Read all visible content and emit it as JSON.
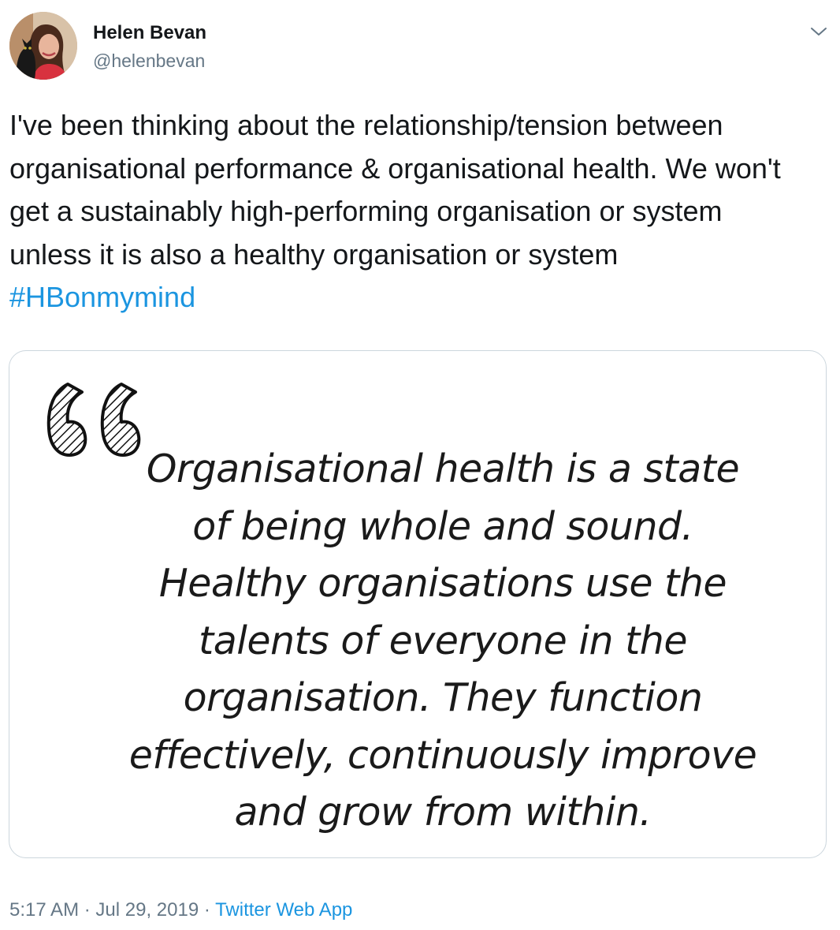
{
  "author": {
    "name": "Helen Bevan",
    "handle": "@helenbevan"
  },
  "tweet": {
    "text": "I've been thinking about the relationship/tension between organisational performance & organisational health. We won't get a sustainably high-performing organisation or system unless it is also a healthy organisation or system",
    "hashtag": "#HBonmymind"
  },
  "media": {
    "quote_lines": [
      "Organisational health is a state",
      "of being whole and sound.",
      "Healthy organisations use the",
      "talents of everyone in the",
      "organisation. They function",
      "effectively, continuously improve",
      "and grow from within."
    ]
  },
  "meta": {
    "time": "5:17 AM",
    "separator": "·",
    "date": "Jul 29, 2019",
    "source": "Twitter Web App"
  },
  "colors": {
    "link": "#1b95e0",
    "secondary_text": "#657786",
    "border": "#ccd6dd"
  },
  "icons": {
    "more": "chevron-down-icon",
    "quote": "quote-marks-icon"
  }
}
